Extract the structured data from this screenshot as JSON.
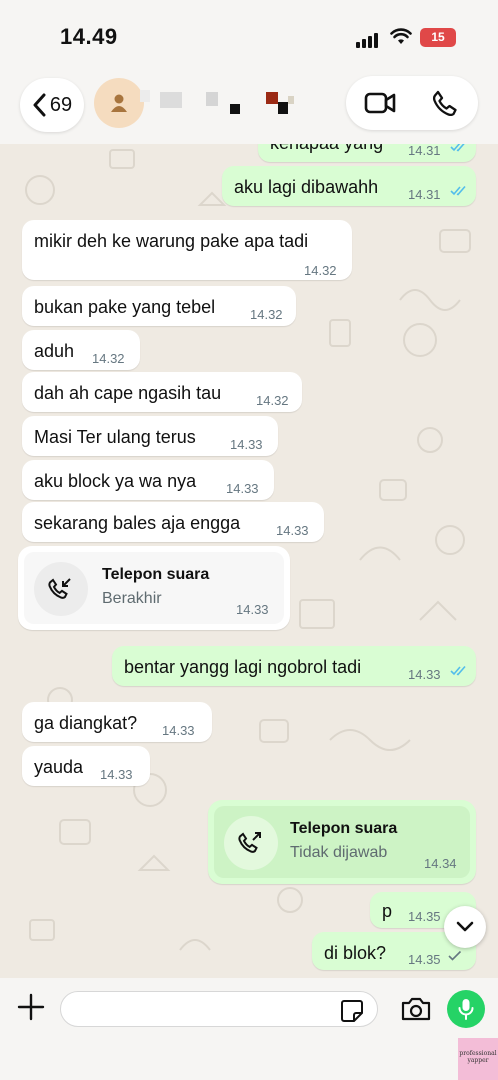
{
  "status_bar": {
    "time": "14.49",
    "battery": "15"
  },
  "header": {
    "back_count": "69"
  },
  "messages": [
    {
      "dir": "out",
      "text": "kenapaa yang",
      "time": "14.31",
      "status": "read"
    },
    {
      "dir": "out",
      "text": "aku lagi dibawahh",
      "time": "14.31",
      "status": "read"
    },
    {
      "dir": "in",
      "text": "mikir deh ke warung pake apa tadi",
      "time": "14.32"
    },
    {
      "dir": "in",
      "text": "bukan pake yang tebel",
      "time": "14.32"
    },
    {
      "dir": "in",
      "text": "aduh",
      "time": "14.32"
    },
    {
      "dir": "in",
      "text": "dah ah cape ngasih tau",
      "time": "14.32"
    },
    {
      "dir": "in",
      "text": "Masi Ter ulang terus",
      "time": "14.33"
    },
    {
      "dir": "in",
      "text": "aku block ya wa nya",
      "time": "14.33"
    },
    {
      "dir": "in",
      "text": "sekarang bales aja engga",
      "time": "14.33"
    },
    {
      "dir": "in",
      "type": "call",
      "title": "Telepon suara",
      "subtitle": "Berakhir",
      "time": "14.33"
    },
    {
      "dir": "out",
      "text": "bentar yangg lagi ngobrol tadi",
      "time": "14.33",
      "status": "read"
    },
    {
      "dir": "in",
      "text": "ga diangkat?",
      "time": "14.33"
    },
    {
      "dir": "in",
      "text": "yauda",
      "time": "14.33"
    },
    {
      "dir": "out",
      "type": "call",
      "title": "Telepon suara",
      "subtitle": "Tidak dijawab",
      "time": "14.34"
    },
    {
      "dir": "out",
      "text": "p",
      "time": "14.35",
      "status": "sent"
    },
    {
      "dir": "out",
      "text": "di blok?",
      "time": "14.35",
      "status": "sent"
    }
  ],
  "watermark": {
    "line1": "professional",
    "line2": "yapper"
  },
  "colors": {
    "incoming": "#ffffff",
    "outgoing": "#d9fdd3",
    "read_ticks": "#53bdeb",
    "mic": "#25d366",
    "battery": "#e04848"
  }
}
